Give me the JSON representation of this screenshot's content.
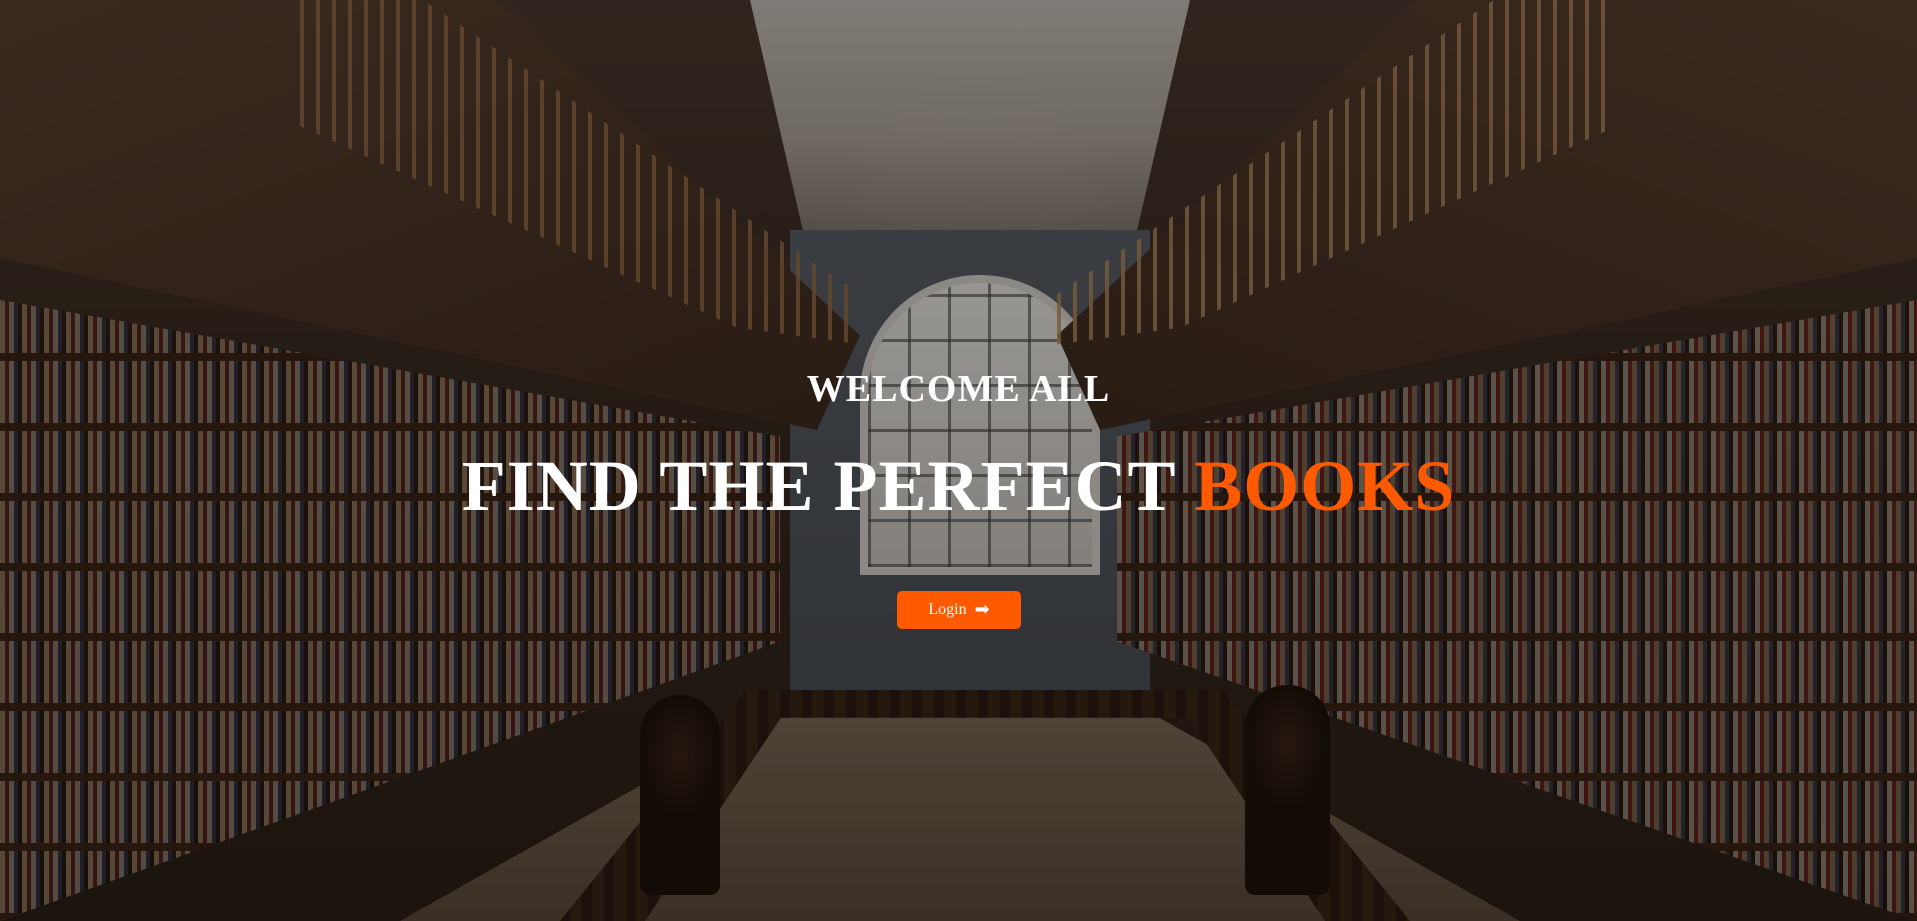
{
  "hero": {
    "welcome": "WELCOME ALL",
    "headline_main": "FIND THE PERFECT",
    "headline_accent": "BOOKS",
    "login_label": "Login",
    "login_icon": "arrow-right-icon",
    "accent_color": "#ff5a00"
  }
}
